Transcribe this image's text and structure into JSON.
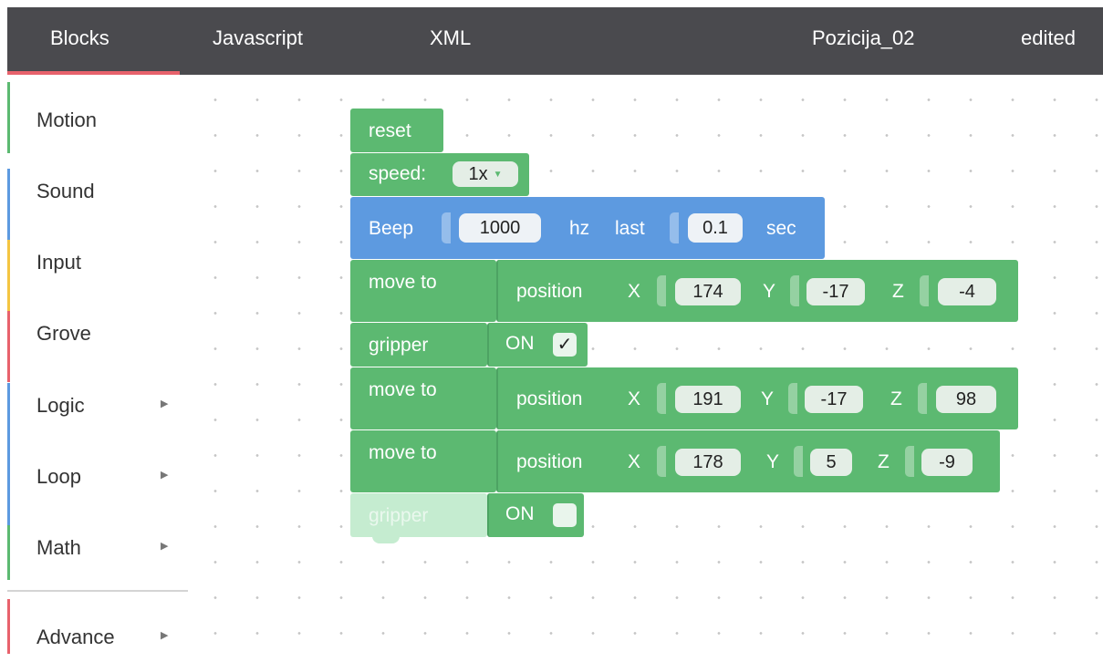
{
  "header": {
    "tabs": [
      {
        "label": "Blocks",
        "active": true
      },
      {
        "label": "Javascript",
        "active": false
      },
      {
        "label": "XML",
        "active": false
      }
    ],
    "filename": "Pozicija_02",
    "status": "edited",
    "accent_color": "#e8626c"
  },
  "toolbox": {
    "categories": [
      {
        "label": "Motion",
        "color": "#5cb971",
        "has_submenu": false
      },
      {
        "label": "Sound",
        "color": "#5d9ae0",
        "has_submenu": false
      },
      {
        "label": "Input",
        "color": "#f4c542",
        "has_submenu": false
      },
      {
        "label": "Grove",
        "color": "#e8626c",
        "has_submenu": false
      },
      {
        "label": "Logic",
        "color": "#5d9ae0",
        "has_submenu": true
      },
      {
        "label": "Loop",
        "color": "#5d9ae0",
        "has_submenu": true
      },
      {
        "label": "Math",
        "color": "#5cb971",
        "has_submenu": true
      }
    ],
    "advance": {
      "label": "Advance",
      "color": "#e8626c",
      "has_submenu": true
    },
    "submenu_icon": "triangle-right-icon"
  },
  "blocks": {
    "reset": {
      "label": "reset"
    },
    "speed": {
      "label": "speed:",
      "value": "1x",
      "icon": "dropdown-arrow-icon"
    },
    "beep": {
      "label": "Beep",
      "freq": "1000",
      "hz": "hz",
      "last": "last",
      "duration": "0.1",
      "sec": "sec"
    },
    "moves": [
      {
        "label": "move to",
        "position": "position",
        "x_label": "X",
        "x": "174",
        "y_label": "Y",
        "y": "-17",
        "z_label": "Z",
        "z": "-4"
      },
      {
        "label": "move to",
        "position": "position",
        "x_label": "X",
        "x": "191",
        "y_label": "Y",
        "y": "-17",
        "z_label": "Z",
        "z": "98"
      },
      {
        "label": "move to",
        "position": "position",
        "x_label": "X",
        "x": "178",
        "y_label": "Y",
        "y": "5",
        "z_label": "Z",
        "z": "-9"
      }
    ],
    "gripper1": {
      "label": "gripper",
      "state": "ON",
      "checked": true,
      "check_mark": "✓"
    },
    "gripper2": {
      "label": "gripper",
      "state": "ON",
      "checked": false
    }
  },
  "colors": {
    "motion_green": "#5cb971",
    "sound_blue": "#5d9ae0",
    "disabled_green": "#c5ecd0",
    "topbar": "#4a4a4e"
  }
}
